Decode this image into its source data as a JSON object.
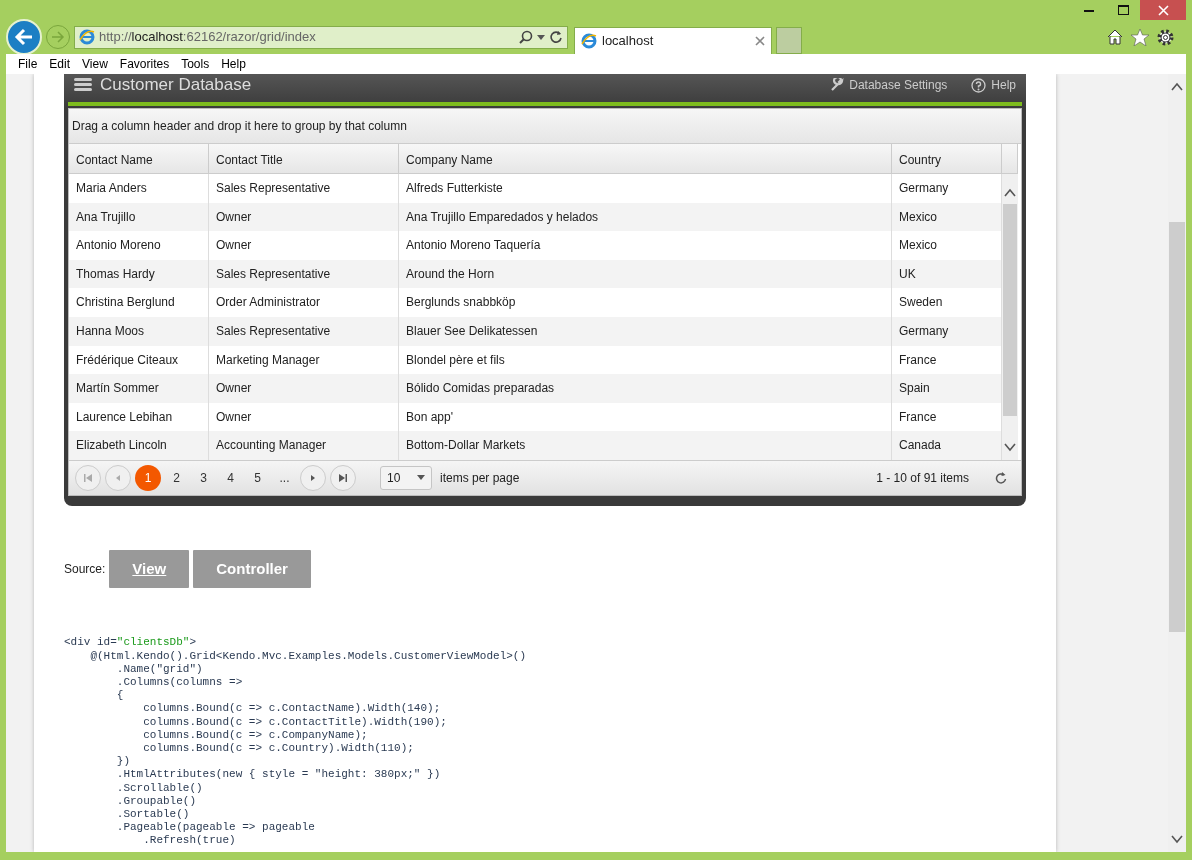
{
  "browser": {
    "address": {
      "scheme": "http://",
      "host": "localhost",
      "rest": ":62162/razor/grid/index"
    },
    "tabs": [
      {
        "label": "localhost",
        "selected": true
      }
    ],
    "menu": [
      "File",
      "Edit",
      "View",
      "Favorites",
      "Tools",
      "Help"
    ]
  },
  "app_header": {
    "title": "Customer Database",
    "actions": [
      {
        "label": "Database Settings",
        "kind": "settings"
      },
      {
        "label": "Help",
        "kind": "help"
      }
    ]
  },
  "grid": {
    "group_hint": "Drag a column header and drop it here to group by that column",
    "columns": [
      "Contact Name",
      "Contact Title",
      "Company Name",
      "Country"
    ],
    "rows": [
      [
        "Maria Anders",
        "Sales Representative",
        "Alfreds Futterkiste",
        "Germany"
      ],
      [
        "Ana Trujillo",
        "Owner",
        "Ana Trujillo Emparedados y helados",
        "Mexico"
      ],
      [
        "Antonio Moreno",
        "Owner",
        "Antonio Moreno Taquería",
        "Mexico"
      ],
      [
        "Thomas Hardy",
        "Sales Representative",
        "Around the Horn",
        "UK"
      ],
      [
        "Christina Berglund",
        "Order Administrator",
        "Berglunds snabbköp",
        "Sweden"
      ],
      [
        "Hanna Moos",
        "Sales Representative",
        "Blauer See Delikatessen",
        "Germany"
      ],
      [
        "Frédérique Citeaux",
        "Marketing Manager",
        "Blondel père et fils",
        "France"
      ],
      [
        "Martín Sommer",
        "Owner",
        "Bólido Comidas preparadas",
        "Spain"
      ],
      [
        "Laurence Lebihan",
        "Owner",
        "Bon app'",
        "France"
      ],
      [
        "Elizabeth Lincoln",
        "Accounting Manager",
        "Bottom-Dollar Markets",
        "Canada"
      ]
    ],
    "pager": {
      "pages": [
        {
          "label": "1",
          "selected": true
        },
        {
          "label": "2",
          "selected": false
        },
        {
          "label": "3",
          "selected": false
        },
        {
          "label": "4",
          "selected": false
        },
        {
          "label": "5",
          "selected": false
        },
        {
          "label": "...",
          "selected": false
        }
      ],
      "page_size": "10",
      "page_size_label": "items per page",
      "info": "1 - 10 of 91 items"
    }
  },
  "source": {
    "label": "Source:",
    "buttons": [
      {
        "label": "View",
        "selected": true
      },
      {
        "label": "Controller",
        "selected": false
      }
    ]
  },
  "code": [
    [
      {
        "text": "<div id=",
        "kind": "plain"
      },
      {
        "text": "\"clientsDb\"",
        "kind": "string"
      },
      {
        "text": ">",
        "kind": "plain"
      }
    ],
    [
      {
        "text": "    @(Html.Kendo().Grid<Kendo.Mvc.Examples.Models.CustomerViewModel>()",
        "kind": "plain"
      }
    ],
    [
      {
        "text": "        .Name(\"grid\")",
        "kind": "plain"
      }
    ],
    [
      {
        "text": "        .Columns(columns =>",
        "kind": "plain"
      }
    ],
    [
      {
        "text": "        {",
        "kind": "plain"
      }
    ],
    [
      {
        "text": "            columns.Bound(c => c.ContactName).Width(140);",
        "kind": "plain"
      }
    ],
    [
      {
        "text": "            columns.Bound(c => c.ContactTitle).Width(190);",
        "kind": "plain"
      }
    ],
    [
      {
        "text": "            columns.Bound(c => c.CompanyName);",
        "kind": "plain"
      }
    ],
    [
      {
        "text": "            columns.Bound(c => c.Country).Width(110);",
        "kind": "plain"
      }
    ],
    [
      {
        "text": "        })",
        "kind": "plain"
      }
    ],
    [
      {
        "text": "        .HtmlAttributes(new { style = \"height: 380px;\" })",
        "kind": "plain"
      }
    ],
    [
      {
        "text": "        .Scrollable()",
        "kind": "plain"
      }
    ],
    [
      {
        "text": "        .Groupable()",
        "kind": "plain"
      }
    ],
    [
      {
        "text": "        .Sortable()",
        "kind": "plain"
      }
    ],
    [
      {
        "text": "        .Pageable(pageable => pageable",
        "kind": "plain"
      }
    ],
    [
      {
        "text": "            .Refresh(true)",
        "kind": "plain"
      }
    ]
  ]
}
